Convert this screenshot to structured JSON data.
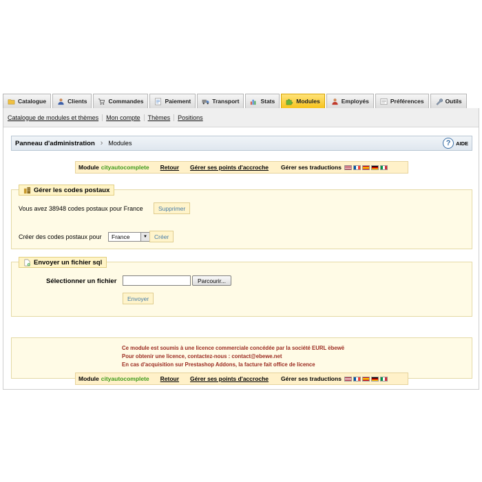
{
  "tabs": [
    {
      "label": "Catalogue",
      "icon": "folder-icon",
      "active": false
    },
    {
      "label": "Clients",
      "icon": "user-icon",
      "active": false
    },
    {
      "label": "Commandes",
      "icon": "cart-icon",
      "active": false
    },
    {
      "label": "Paiement",
      "icon": "payment-icon",
      "active": false
    },
    {
      "label": "Transport",
      "icon": "truck-icon",
      "active": false
    },
    {
      "label": "Stats",
      "icon": "chart-icon",
      "active": false
    },
    {
      "label": "Modules",
      "icon": "puzzle-icon",
      "active": true
    },
    {
      "label": "Employés",
      "icon": "employee-icon",
      "active": false
    },
    {
      "label": "Préférences",
      "icon": "preferences-icon",
      "active": false
    },
    {
      "label": "Outils",
      "icon": "wrench-icon",
      "active": false
    }
  ],
  "subnav": [
    "Catalogue de modules et thèmes",
    "Mon compte",
    "Thèmes",
    "Positions"
  ],
  "breadcrumb": {
    "home": "Panneau d'administration",
    "current": "Modules",
    "help": "AIDE"
  },
  "module_bar": {
    "prefix": "Module",
    "name": "cityautocomplete",
    "back": "Retour",
    "hooks": "Gérer ses points d'accroche",
    "translations": "Gérer ses traductions",
    "flags": [
      "en",
      "fr",
      "es",
      "de",
      "it"
    ]
  },
  "postal": {
    "legend": "Gérer les codes postaux",
    "count_text": "Vous avez 38948 codes postaux pour France",
    "delete_button": "Supprimer",
    "create_label": "Créer des codes postaux pour",
    "country": "France",
    "create_button": "Créer"
  },
  "sql": {
    "legend": "Envoyer un fichier sql",
    "select_label": "Sélectionner un fichier",
    "file_value": "",
    "browse_button": "Parcourir...",
    "send_button": "Envoyer"
  },
  "licence": [
    "Ce module est soumis à une licence commerciale concédée par la société EURL ëbewë",
    "Pour obtenir une licence, contactez-nous : contact@ebewe.net",
    "En cas d'acquisition sur Prestashop Addons, la facture fait office de licence"
  ],
  "colors": {
    "active_tab": "#f7c31c",
    "module_name": "#3e9a1a",
    "licence_text": "#9b2a1f",
    "button_text": "#447ba8"
  }
}
